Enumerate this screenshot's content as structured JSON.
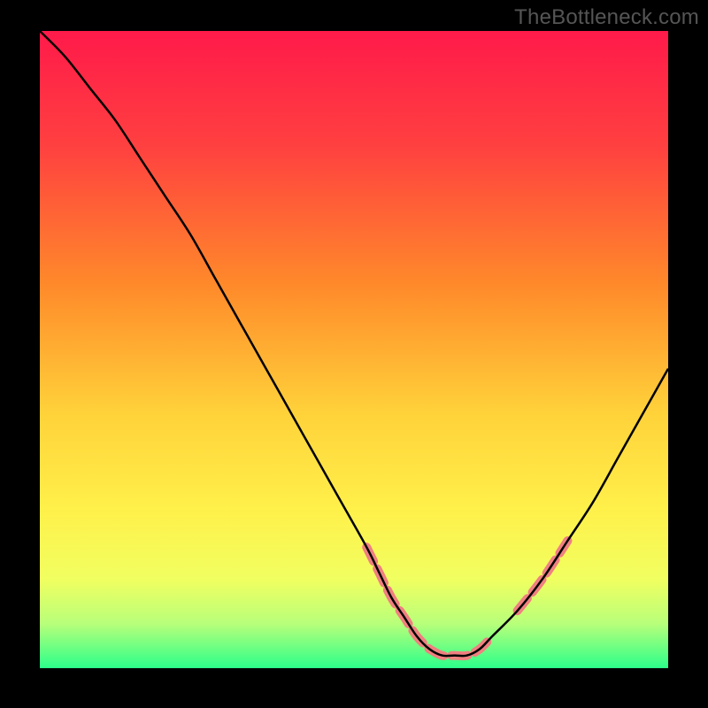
{
  "watermark": "TheBottleneck.com",
  "chart_data": {
    "type": "line",
    "title": "",
    "xlabel": "",
    "ylabel": "",
    "xlim": [
      0,
      100
    ],
    "ylim": [
      0,
      100
    ],
    "grid": false,
    "legend": false,
    "gradient_stops": [
      {
        "offset": 0.0,
        "color": "#ff1a4a"
      },
      {
        "offset": 0.18,
        "color": "#ff4040"
      },
      {
        "offset": 0.4,
        "color": "#ff8a2a"
      },
      {
        "offset": 0.6,
        "color": "#ffd23a"
      },
      {
        "offset": 0.75,
        "color": "#fff04a"
      },
      {
        "offset": 0.86,
        "color": "#f1ff60"
      },
      {
        "offset": 0.93,
        "color": "#b8ff7a"
      },
      {
        "offset": 1.0,
        "color": "#2cff8a"
      }
    ],
    "series": [
      {
        "name": "bottleneck-curve",
        "x": [
          0,
          4,
          8,
          12,
          16,
          20,
          24,
          28,
          32,
          36,
          40,
          44,
          48,
          52,
          54,
          56,
          58,
          60,
          62,
          64,
          66,
          68,
          70,
          72,
          76,
          80,
          84,
          88,
          92,
          96,
          100
        ],
        "y": [
          100,
          96,
          91,
          86,
          80,
          74,
          68,
          61,
          54,
          47,
          40,
          33,
          26,
          19,
          15,
          11,
          8,
          5,
          3,
          2,
          2,
          2,
          3,
          5,
          9,
          14,
          20,
          26,
          33,
          40,
          47
        ],
        "color": "#000000",
        "stroke_width": 2.5
      }
    ],
    "highlight_segments": [
      {
        "name": "dashed-left",
        "color": "#f08080",
        "stroke_width": 10,
        "dash": "18 9",
        "points_x": [
          52,
          54,
          56,
          58,
          60,
          62
        ],
        "points_y": [
          19,
          15,
          11,
          8,
          5,
          3
        ]
      },
      {
        "name": "dashed-bottom",
        "color": "#f08080",
        "stroke_width": 10,
        "dash": "18 9",
        "points_x": [
          62,
          64,
          66,
          68,
          70,
          72
        ],
        "points_y": [
          3,
          2,
          2,
          2,
          3,
          5
        ]
      },
      {
        "name": "dashed-right",
        "color": "#f08080",
        "stroke_width": 10,
        "dash": "18 9",
        "points_x": [
          76,
          80,
          84
        ],
        "points_y": [
          9,
          14,
          20
        ]
      }
    ]
  }
}
